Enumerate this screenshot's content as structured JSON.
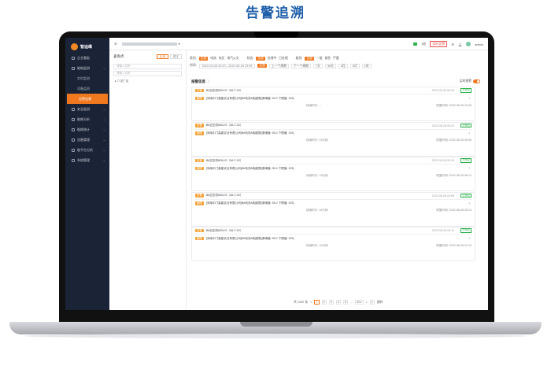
{
  "page": {
    "title": "告警追溯"
  },
  "sidebar": {
    "brand": "智运维",
    "items": [
      {
        "label": "企业看板",
        "expandable": false
      },
      {
        "label": "能耗监测",
        "expandable": true
      },
      {
        "label": "实时监测",
        "sub": true
      },
      {
        "label": "设备监测",
        "sub": true
      },
      {
        "label": "告警追溯",
        "sub": true,
        "active": true
      },
      {
        "label": "安全监测",
        "expandable": true
      },
      {
        "label": "能耗分析",
        "expandable": true
      },
      {
        "label": "能耗统计",
        "expandable": true
      },
      {
        "label": "设备管理",
        "expandable": true
      },
      {
        "label": "能平台分析",
        "expandable": true
      },
      {
        "label": "系统管理",
        "expandable": true
      }
    ]
  },
  "topbar": {
    "menu_icon": "menu-icon",
    "org_selector": "▾",
    "status_text": "1处",
    "alarm_badge": "实时告警",
    "user": "admin"
  },
  "left_panel": {
    "title": "查询点",
    "btn_primary": "区域",
    "btn_secondary": "楼宇",
    "search_placeholder": "请输入名称",
    "search_placeholder2": "请输入名称",
    "tree_root": "总厂区"
  },
  "filters": {
    "row1": {
      "type_label": "类别:",
      "type_options": [
        "全部",
        "电流",
        "电压",
        "电气火灾"
      ],
      "type_active": 0,
      "state_label": "状态:",
      "state_options": [
        "全部",
        "处理中",
        "已处理"
      ],
      "state_active": 0,
      "level_label": "级别:",
      "level_options": [
        "全部",
        "一般",
        "紧急",
        "严重"
      ],
      "level_active": 0
    },
    "row2": {
      "time_label": "时间:",
      "start": "2022-03-28 00:00",
      "range_sep": "→",
      "end": "2022-06-28 23:59",
      "quick_active": "全部",
      "buttons": [
        "上一个周期",
        "下一个周期",
        "7天",
        "30天",
        "3月",
        "6月",
        "1年"
      ]
    }
  },
  "list": {
    "title": "报警信息",
    "realtime_label": "实时报警",
    "alarms": [
      {
        "tag": "告警",
        "title": "B#空压机800L/S（3A-T-02）",
        "time": "2022-06-28 06:18",
        "status": "已恢复",
        "level": "越限",
        "detail": "[河南中门高能实业有限公司]B#电流A相越限(原阈值: 54.2 下限值: 193)",
        "duration": "持续时长: --",
        "reset": "恢复时间: 2022-06-28 20:08"
      },
      {
        "tag": "告警",
        "title": "B#空压机800L/S（3A-T-02）",
        "time": "2022-06-28 05:41",
        "status": "已恢复",
        "level": "越限",
        "detail": "[河南中门高能实业有限公司]B#电流A相越限(原阈值: 55.4 下限值: 193)",
        "duration": "持续时长: 23分钟",
        "reset": "恢复时间: 2022-06-28 08:45"
      },
      {
        "tag": "告警",
        "title": "B#空压机800L/S（3A-T-02）",
        "time": "2022-06-28 05:15",
        "status": "已恢复",
        "level": "越限",
        "detail": "[河南中门高能实业有限公司]B#电流A相越限(原阈值: 55.4 下限值: 193)",
        "duration": "持续时长: 13分钟",
        "reset": "恢复时间: 2022-06-28 06:12"
      },
      {
        "tag": "告警",
        "title": "B#空压机800L/S（3A-T-02）",
        "time": "2022-06-28 04:58",
        "status": "已恢复",
        "level": "越限",
        "detail": "[河南中门高能实业有限公司]B#电流A相越限(原阈值: 55.2 下限值: 193)",
        "duration": "持续时长: 16分钟",
        "reset": "恢复时间: 2022-06-28 05:13"
      },
      {
        "tag": "告警",
        "title": "B#空压机800L/S（3A-T-02）",
        "time": "2022-06-28 04:11",
        "status": "已恢复",
        "level": "越限",
        "detail": "[河南中门高能实业有限公司]B#电流A相越限(原阈值: 55.2 下限值: 193)",
        "duration": "持续时长: 10分钟",
        "reset": "恢复时间: 2022-06-28 04:13"
      }
    ]
  },
  "pager": {
    "total": "共 1002 条",
    "prev": "<",
    "pages": [
      "1",
      "2",
      "3",
      "4",
      "5"
    ],
    "active": "1",
    "ellipsis": "...",
    "last": "201",
    "next": ">",
    "goto": "1",
    "goto_label": "跳转"
  },
  "colors": {
    "accent": "#f0781e",
    "sidebar": "#1b2336",
    "title": "#1f5faa",
    "ok": "#2bb24c"
  }
}
